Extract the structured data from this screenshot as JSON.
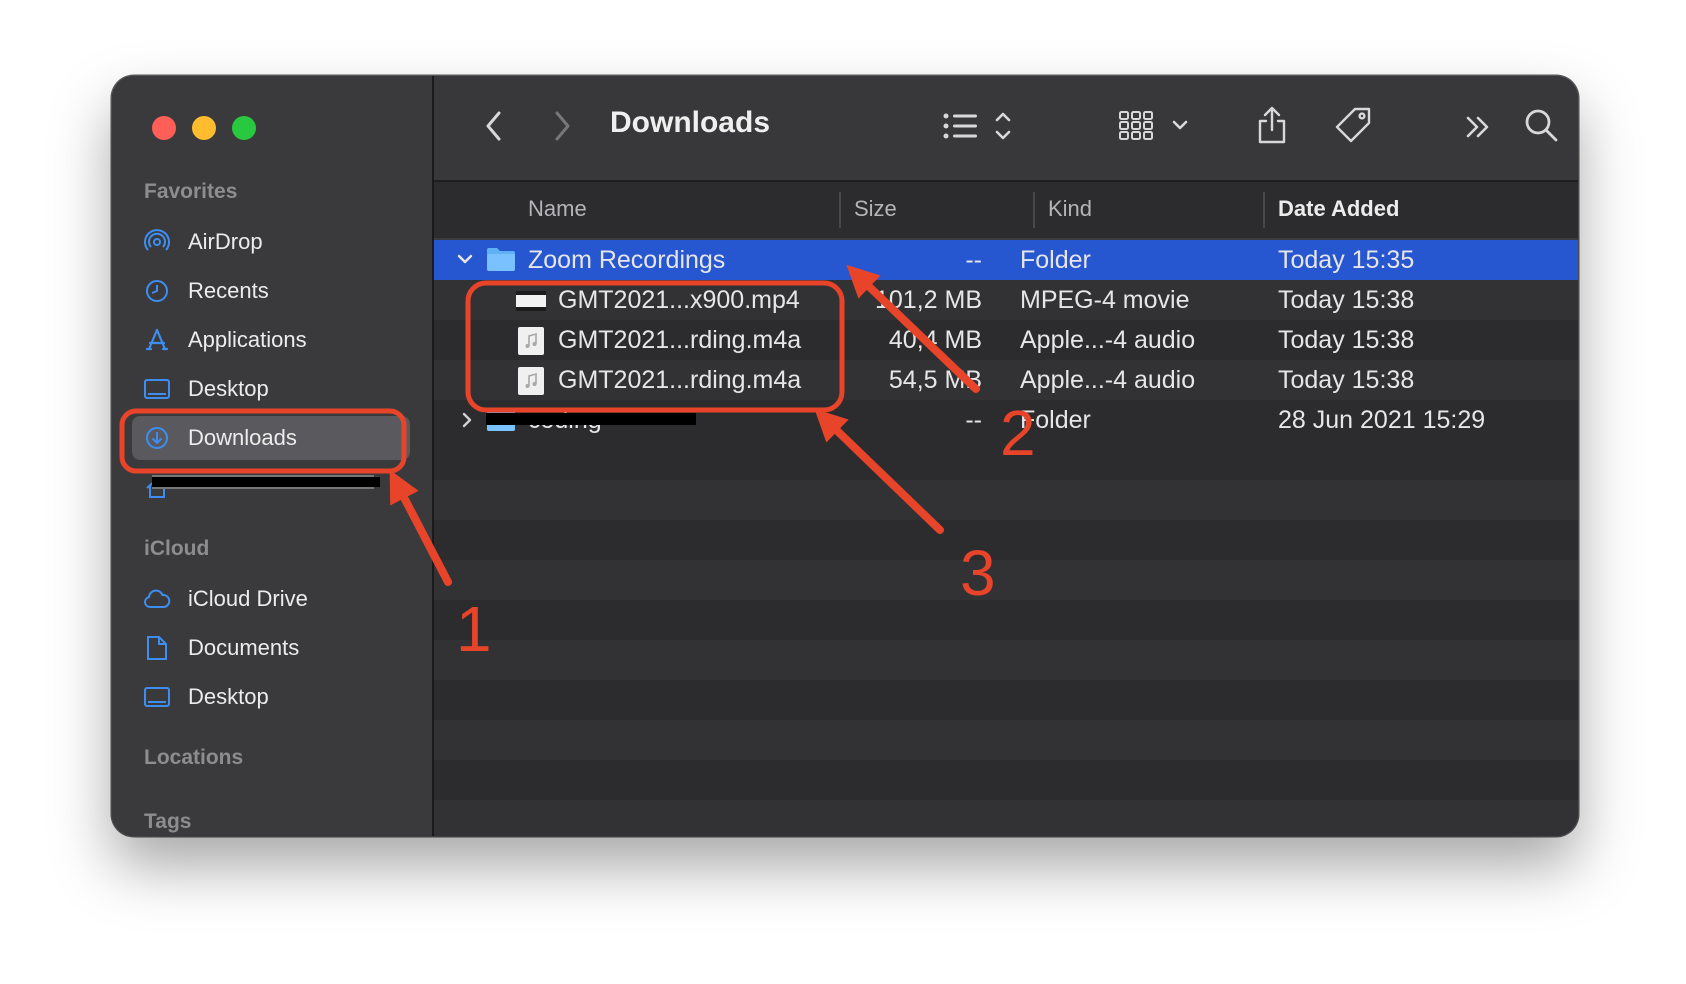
{
  "window": {
    "title": "Downloads",
    "sidebar": {
      "sections": [
        {
          "title": "Favorites"
        },
        {
          "title": "iCloud"
        },
        {
          "title": "Locations"
        },
        {
          "title": "Tags"
        }
      ],
      "favorites": [
        {
          "label": "AirDrop",
          "icon": "airdrop-icon"
        },
        {
          "label": "Recents",
          "icon": "clock-icon"
        },
        {
          "label": "Applications",
          "icon": "applications-icon"
        },
        {
          "label": "Desktop",
          "icon": "desktop-icon"
        },
        {
          "label": "Downloads",
          "icon": "download-icon",
          "selected": true
        }
      ],
      "icloud": [
        {
          "label": "iCloud Drive",
          "icon": "cloud-icon"
        },
        {
          "label": "Documents",
          "icon": "document-icon"
        },
        {
          "label": "Desktop",
          "icon": "desktop-icon"
        }
      ]
    },
    "toolbar": {
      "icons": [
        "back-icon",
        "forward-icon",
        "list-view-icon",
        "grid-view-icon",
        "share-icon",
        "tag-icon",
        "more-icon",
        "search-icon"
      ]
    },
    "columns": {
      "name": "Name",
      "size": "Size",
      "kind": "Kind",
      "date": "Date Added"
    },
    "rows": [
      {
        "name": "Zoom Recordings",
        "size": "--",
        "kind": "Folder",
        "date": "Today 15:35",
        "type": "folder",
        "expanded": true,
        "selected": true
      },
      {
        "name": "GMT2021...x900.mp4",
        "size": "101,2 MB",
        "kind": "MPEG-4 movie",
        "date": "Today 15:38",
        "type": "video"
      },
      {
        "name": "GMT2021...rding.m4a",
        "size": "40,4 MB",
        "kind": "Apple...-4 audio",
        "date": "Today 15:38",
        "type": "audio"
      },
      {
        "name": "GMT2021...rding.m4a",
        "size": "54,5 MB",
        "kind": "Apple...-4 audio",
        "date": "Today 15:38",
        "type": "audio"
      },
      {
        "name": "coding",
        "size": "--",
        "kind": "Folder",
        "date": "28 Jun 2021 15:29",
        "type": "folder",
        "expanded": false
      }
    ],
    "annotations": [
      "1",
      "2",
      "3"
    ],
    "colors": {
      "annotation": "#e8442a",
      "selection": "#2757d0"
    }
  }
}
